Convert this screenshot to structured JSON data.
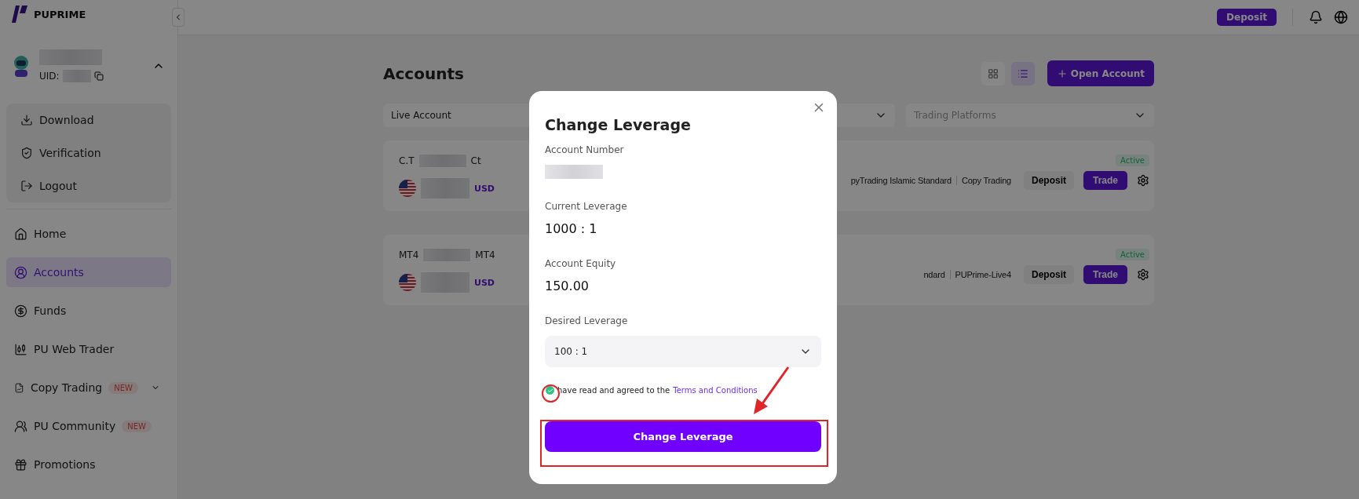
{
  "brand": {
    "name": "PUPRIME"
  },
  "topbar": {
    "deposit": "Deposit"
  },
  "user": {
    "uid_label": "UID:",
    "expanded": true
  },
  "user_menu": [
    {
      "label": "Download"
    },
    {
      "label": "Verification"
    },
    {
      "label": "Logout"
    }
  ],
  "nav": [
    {
      "label": "Home",
      "selected": false
    },
    {
      "label": "Accounts",
      "selected": true
    },
    {
      "label": "Funds",
      "selected": false
    },
    {
      "label": "PU Web Trader",
      "selected": false
    },
    {
      "label": "Copy Trading",
      "selected": false,
      "badge": "NEW",
      "submenu": true
    },
    {
      "label": "PU Community",
      "selected": false,
      "badge": "NEW"
    },
    {
      "label": "Promotions",
      "selected": false
    }
  ],
  "page": {
    "title": "Accounts",
    "open_account": "Open Account",
    "views": [
      {
        "kind": "grid",
        "selected": false
      },
      {
        "kind": "list",
        "selected": true
      }
    ],
    "filters": [
      {
        "label": "Live Account",
        "kind": "value"
      },
      {
        "label": "Trading Platforms",
        "kind": "placeholder"
      }
    ]
  },
  "accounts": [
    {
      "name_start": "C.T",
      "name_end": "Ct",
      "currency": "USD",
      "status": "Active",
      "details": [
        "pyTrading Islamic Standard",
        "Copy Trading"
      ],
      "deposit": "Deposit",
      "trade": "Trade"
    },
    {
      "name_start": "MT4",
      "name_end": "MT4",
      "currency": "USD",
      "status": "Active",
      "details": [
        "ndard",
        "PUPrime-Live4"
      ],
      "deposit": "Deposit",
      "trade": "Trade"
    }
  ],
  "modal": {
    "title": "Change Leverage",
    "fields": [
      {
        "label": "Account Number",
        "kind": "redacted"
      },
      {
        "label": "Current Leverage",
        "kind": "text",
        "value": "1000 : 1"
      },
      {
        "label": "Account Equity",
        "kind": "text",
        "value": "150.00"
      }
    ],
    "desired": {
      "label": "Desired Leverage",
      "value": "100 : 1"
    },
    "agreement": {
      "checked": true,
      "text": "have read and agreed to the",
      "link": "Terms and Conditions"
    },
    "submit": "Change Leverage"
  }
}
